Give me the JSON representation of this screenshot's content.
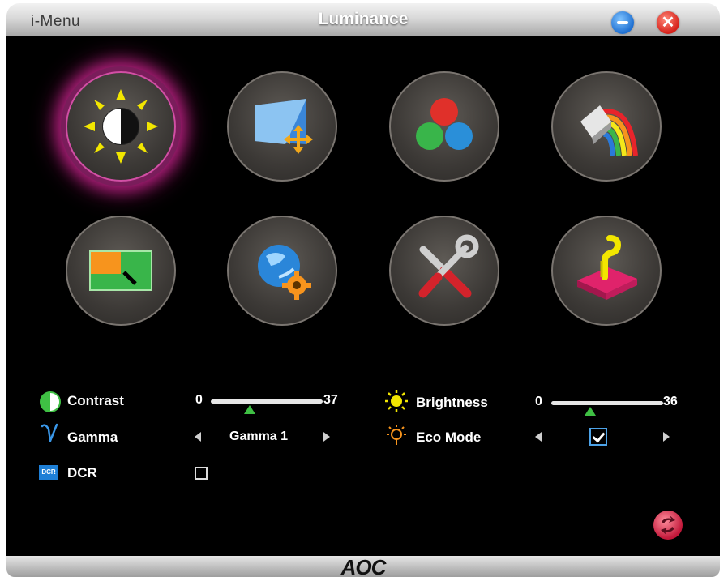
{
  "window": {
    "app_name": "i-Menu",
    "title": "Luminance",
    "close_glyph": "✕"
  },
  "icons": [
    {
      "name": "luminance-icon",
      "active": true
    },
    {
      "name": "image-setup-icon",
      "active": false
    },
    {
      "name": "color-temp-icon",
      "active": false
    },
    {
      "name": "color-boost-icon",
      "active": false
    },
    {
      "name": "picture-boost-icon",
      "active": false
    },
    {
      "name": "osd-setup-icon",
      "active": false
    },
    {
      "name": "extra-icon",
      "active": false
    },
    {
      "name": "exit-icon",
      "active": false
    }
  ],
  "settings": {
    "contrast": {
      "label": "Contrast",
      "min": "0",
      "max": "37",
      "value_fraction": 0.35
    },
    "brightness": {
      "label": "Brightness",
      "min": "0",
      "max": "36",
      "value_fraction": 0.35
    },
    "gamma": {
      "label": "Gamma",
      "value": "Gamma 1"
    },
    "eco_mode": {
      "label": "Eco Mode",
      "checked": true
    },
    "dcr": {
      "label": "DCR",
      "checked": false,
      "icon_text": "DCR"
    }
  },
  "footer": {
    "logo": "AOC"
  },
  "colors": {
    "accent_active": "#b0207c",
    "slider_thumb": "#3fc044",
    "background": "#000000"
  }
}
